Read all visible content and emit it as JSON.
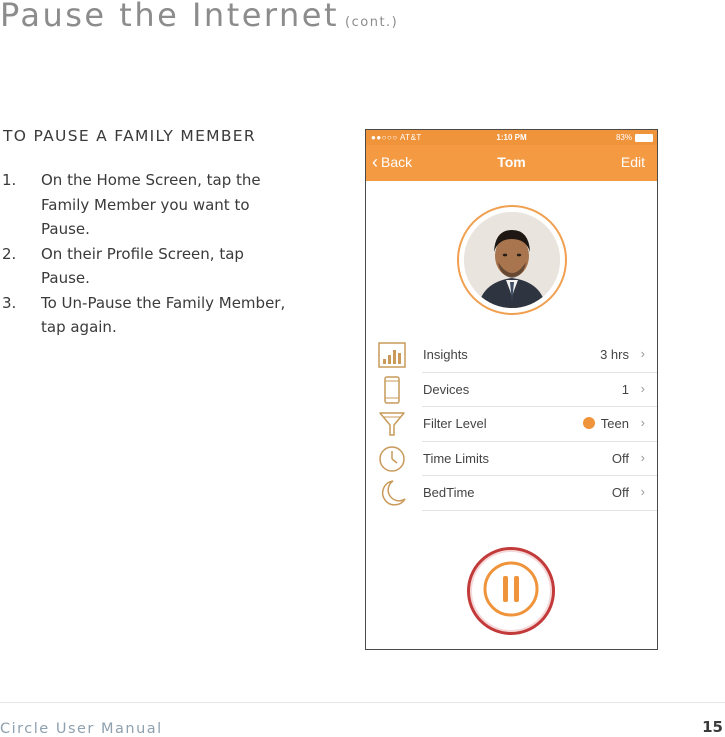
{
  "page": {
    "title": "Pause the Internet",
    "title_suffix": "(cont.)",
    "section_heading": "TO PAUSE A FAMILY MEMBER",
    "steps": [
      {
        "num": "1.",
        "text": "On the Home Screen, tap the Family Member you want to Pause."
      },
      {
        "num": "2.",
        "text": "On their Profile Screen, tap Pause."
      },
      {
        "num": "3.",
        "text": "To Un-Pause the Family Member, tap again."
      }
    ],
    "footer_text": "Circle User Manual",
    "page_number": "15"
  },
  "phone": {
    "status_bar": {
      "carrier": "●●○○○ AT&T",
      "time": "1:10 PM",
      "battery": "83%"
    },
    "nav_bar": {
      "back_label": "Back",
      "title": "Tom",
      "edit_label": "Edit"
    },
    "menu_items": [
      {
        "label": "Insights",
        "value": "3 hrs",
        "icon": "insights-bar-icon"
      },
      {
        "label": "Devices",
        "value": "1",
        "icon": "device-phone-icon"
      },
      {
        "label": "Filter Level",
        "value": "Teen",
        "icon": "filter-funnel-icon"
      },
      {
        "label": "Time Limits",
        "value": "Off",
        "icon": "clock-icon"
      },
      {
        "label": "BedTime",
        "value": "Off",
        "icon": "moon-icon"
      }
    ],
    "pause_button_icon": "pause-icon"
  },
  "colors": {
    "accent_orange": "#f39a43",
    "pause_ring_red": "#c23a3a",
    "title_gray": "#8c8c8c",
    "footer_blue_gray": "#8fa0ae"
  }
}
